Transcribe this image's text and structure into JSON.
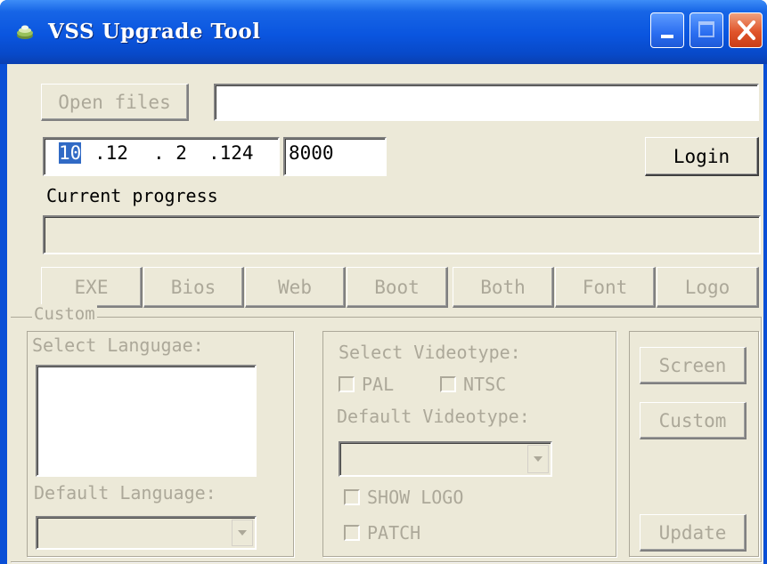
{
  "window": {
    "title": "VSS Upgrade Tool"
  },
  "toolbar": {
    "open_files_label": "Open files",
    "file_path_value": "",
    "ip_octets": [
      "10",
      ".12",
      ". 2",
      ".124"
    ],
    "port_value": "8000",
    "login_label": "Login"
  },
  "progress": {
    "label": "Current progress",
    "value": 0
  },
  "upgrade_buttons": [
    "EXE",
    "Bios",
    "Web",
    "Boot",
    "Both",
    "Font",
    "Logo"
  ],
  "custom": {
    "group_label": "Custom",
    "select_language_label": "Select Langugae:",
    "default_language_label": "Default Language:",
    "select_videotype_label": "Select Videotype:",
    "pal_label": "PAL",
    "ntsc_label": "NTSC",
    "default_videotype_label": "Default Videotype:",
    "show_logo_label": "SHOW LOGO",
    "patch_label": "PATCH",
    "screen_label": "Screen",
    "custom_label": "Custom",
    "update_label": "Update"
  },
  "colors": {
    "title_bar": "#0a55df",
    "face": "#ece9d8",
    "disabled_text": "#aca899",
    "selection": "#316ac5"
  }
}
